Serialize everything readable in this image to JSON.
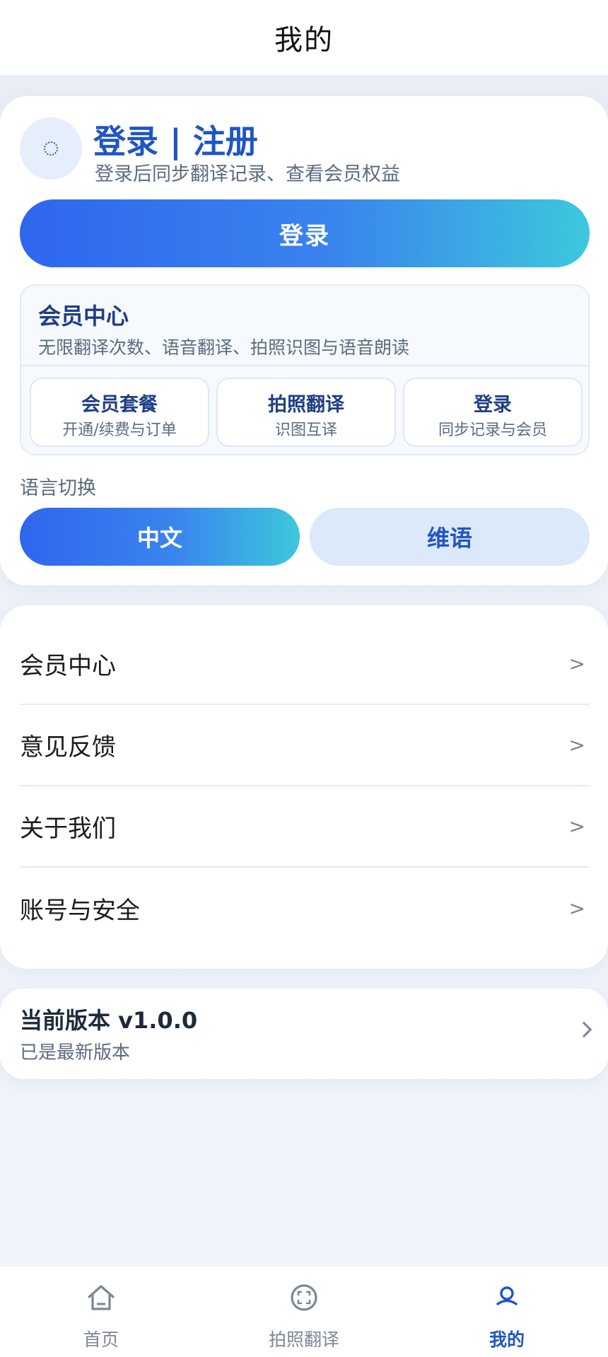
{
  "header": {
    "title": "我的"
  },
  "profile": {
    "title": "登录 | 注册",
    "subtitle": "登录后同步翻译记录、查看会员权益",
    "login_button": "登录"
  },
  "member": {
    "title": "会员中心",
    "description": "无限翻译次数、语音翻译、拍照识图与语音朗读",
    "items": [
      {
        "title": "会员套餐",
        "subtitle": "开通/续费与订单"
      },
      {
        "title": "拍照翻译",
        "subtitle": "识图互译"
      },
      {
        "title": "登录",
        "subtitle": "同步记录与会员"
      }
    ]
  },
  "language": {
    "label": "语言切换",
    "options": [
      "中文",
      "维语"
    ],
    "selected": "中文"
  },
  "menu": {
    "items": [
      {
        "label": "会员中心",
        "arrow": ">"
      },
      {
        "label": "意见反馈",
        "arrow": ">"
      },
      {
        "label": "关于我们",
        "arrow": ">"
      },
      {
        "label": "账号与安全",
        "arrow": ">"
      }
    ]
  },
  "version": {
    "title": "当前版本 v1.0.0",
    "status": "已是最新版本"
  },
  "tabbar": {
    "items": [
      {
        "label": "首页",
        "icon": "home-icon"
      },
      {
        "label": "拍照翻译",
        "icon": "camera-scan-icon"
      },
      {
        "label": "我的",
        "icon": "user-icon"
      }
    ],
    "active": "我的"
  },
  "colors": {
    "accent": "#1f56c4",
    "gradient_start": "#2f66ef",
    "gradient_end": "#3cc8dc",
    "inactive_tab": "#7c8696"
  }
}
